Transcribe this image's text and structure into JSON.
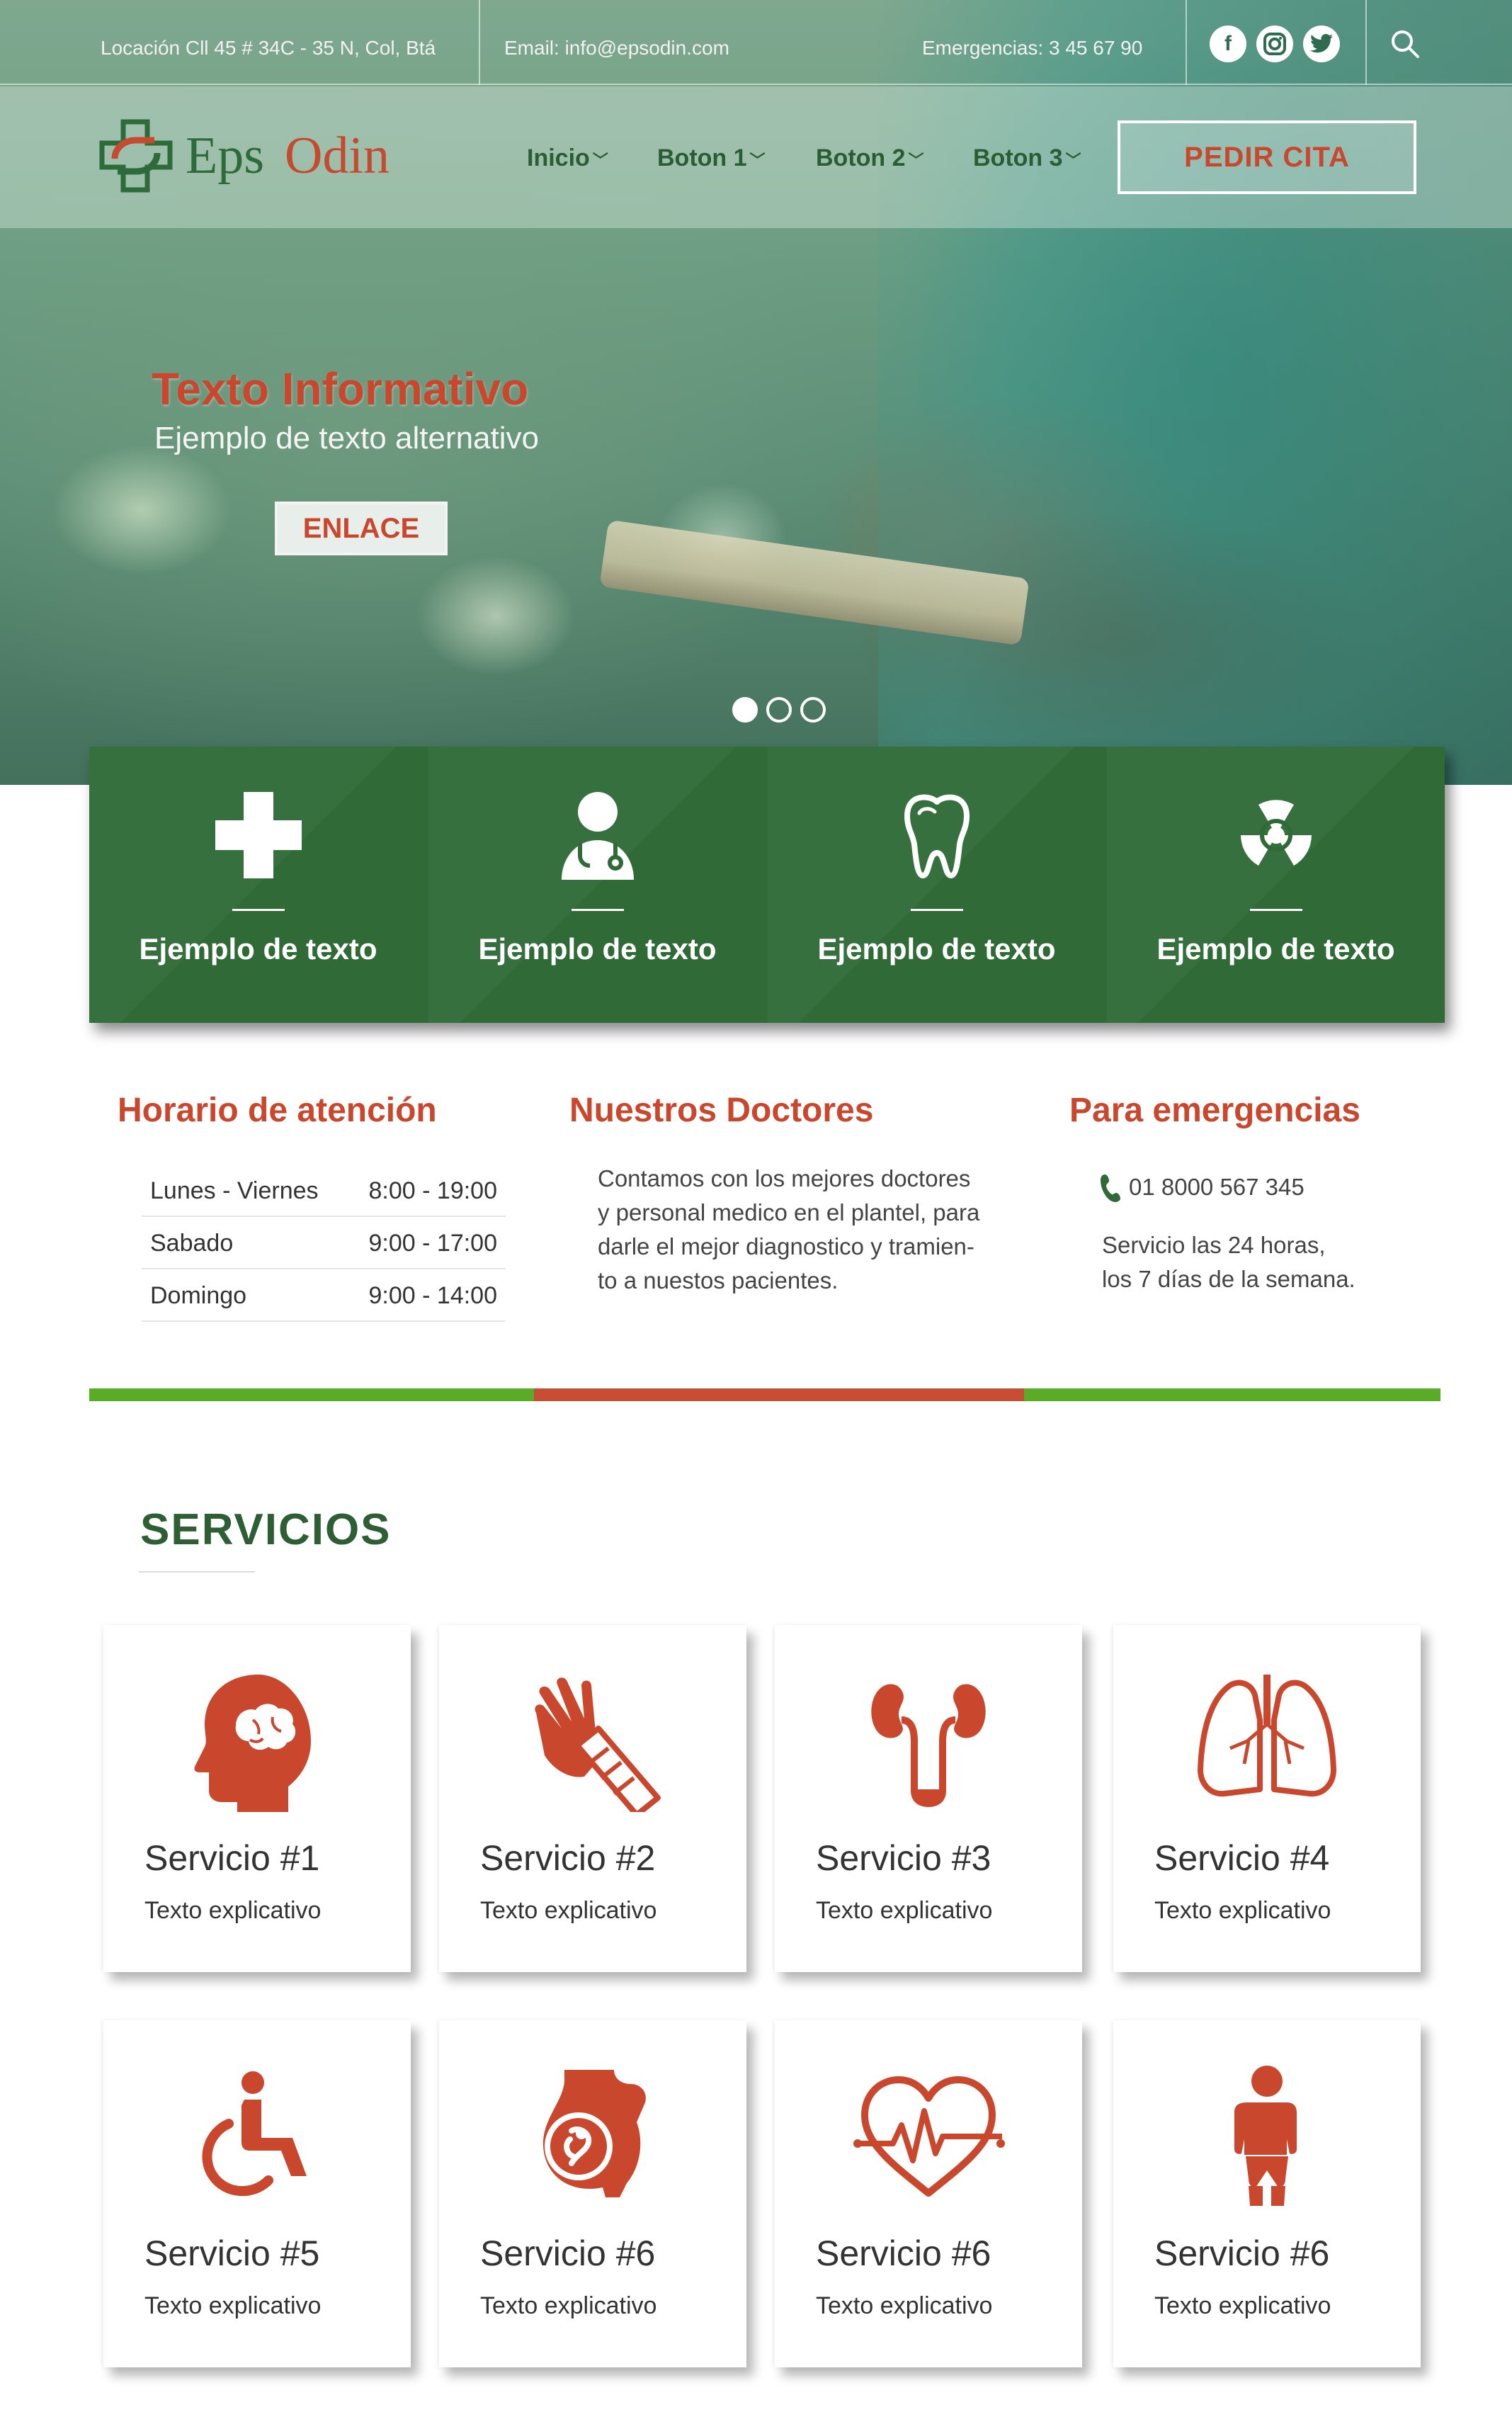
{
  "colors": {
    "brand_green": "#2f6a37",
    "brand_orange": "#c9472d",
    "accent_light_green": "#5aab26",
    "accent_red": "#c74d35",
    "service_icon": "#c9472d"
  },
  "topbar": {
    "location": "Locación Cll 45 # 34C - 35 N, Col, Btá",
    "email": "Email: info@epsodin.com",
    "emergency": "Emergencias: 3 45 67 90",
    "social": [
      {
        "name": "facebook-icon",
        "glyph": "f"
      },
      {
        "name": "instagram-icon",
        "glyph": "◎"
      },
      {
        "name": "twitter-icon",
        "glyph": "✦"
      }
    ],
    "search_icon": "search-icon"
  },
  "nav": {
    "logo_left": "Eps",
    "logo_right": "Odin",
    "items": [
      {
        "label": "Inicio"
      },
      {
        "label": "Boton 1"
      },
      {
        "label": "Boton 2"
      },
      {
        "label": "Boton 3"
      }
    ],
    "cta": "PEDIR CITA"
  },
  "hero": {
    "title": "Texto Informativo",
    "subtitle": "Ejemplo de texto alternativo",
    "link": "ENLACE",
    "slides": 3,
    "active_slide": 1
  },
  "features": [
    {
      "icon": "medical-cross-icon",
      "label": "Ejemplo de texto"
    },
    {
      "icon": "doctor-icon",
      "label": "Ejemplo de texto"
    },
    {
      "icon": "tooth-icon",
      "label": "Ejemplo de texto"
    },
    {
      "icon": "radiation-icon",
      "label": "Ejemplo de texto"
    }
  ],
  "schedule": {
    "title": "Horario de atención",
    "rows": [
      {
        "day": "Lunes - Viernes",
        "time": "8:00 - 19:00"
      },
      {
        "day": "Sabado",
        "time": "9:00 - 17:00"
      },
      {
        "day": "Domingo",
        "time": "9:00 - 14:00"
      }
    ]
  },
  "doctors": {
    "title": "Nuestros Doctores",
    "lines": [
      "Contamos con los mejores doctores",
      "y personal medico en el plantel, para",
      "darle el mejor diagnostico y tramien-",
      "to a nuestos pacientes."
    ]
  },
  "emergencies": {
    "title": "Para emergencias",
    "phone": "01 8000 567 345",
    "lines": [
      "Servicio las 24 horas,",
      "los 7 días de la semana."
    ]
  },
  "services": {
    "title": "SERVICIOS",
    "items": [
      {
        "icon": "brain-head-icon",
        "title": "Servicio #1",
        "text": "Texto explicativo"
      },
      {
        "icon": "bandaged-hand-icon",
        "title": "Servicio #2",
        "text": "Texto explicativo"
      },
      {
        "icon": "kidneys-icon",
        "title": "Servicio #3",
        "text": "Texto explicativo"
      },
      {
        "icon": "lungs-icon",
        "title": "Servicio #4",
        "text": "Texto explicativo"
      },
      {
        "icon": "wheelchair-icon",
        "title": "Servicio #5",
        "text": "Texto explicativo"
      },
      {
        "icon": "pregnancy-icon",
        "title": "Servicio #6",
        "text": "Texto explicativo"
      },
      {
        "icon": "heartbeat-icon",
        "title": "Servicio #6",
        "text": "Texto explicativo"
      },
      {
        "icon": "child-icon",
        "title": "Servicio #6",
        "text": "Texto explicativo"
      }
    ]
  }
}
